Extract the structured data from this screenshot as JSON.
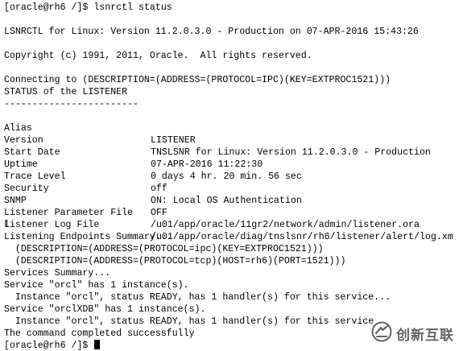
{
  "terminal": {
    "prompt": "[oracle@rh6 /]$ ",
    "command": "lsnrctl status",
    "banner": "LSNRCTL for Linux: Version 11.2.0.3.0 - Production on 07-APR-2016 15:43:26",
    "copyright": "Copyright (c) 1991, 2011, Oracle.  All rights reserved.",
    "connecting": "Connecting to (DESCRIPTION=(ADDRESS=(PROTOCOL=IPC)(KEY=EXTPROC1521)))",
    "status_header": "STATUS of the LISTENER",
    "separator": "------------------------",
    "status_rows": [
      {
        "key": "Alias",
        "value": "LISTENER"
      },
      {
        "key": "Version",
        "value": "TNSLSNR for Linux: Version 11.2.0.3.0 - Production"
      },
      {
        "key": "Start Date",
        "value": "07-APR-2016 11:22:30"
      },
      {
        "key": "Uptime",
        "value": "0 days 4 hr. 20 min. 56 sec"
      },
      {
        "key": "Trace Level",
        "value": "off"
      },
      {
        "key": "Security",
        "value": "ON: Local OS Authentication"
      },
      {
        "key": "SNMP",
        "value": "OFF"
      },
      {
        "key": "Listener Parameter File",
        "value": "/u01/app/oracle/11gr2/network/admin/listener.ora"
      },
      {
        "key": "Listener Log File",
        "value": "/u01/app/oracle/diag/tnslsnr/rh6/listener/alert/log.xm"
      }
    ],
    "log_wrap": "l",
    "endpoints_header": "Listening Endpoints Summary...",
    "endpoint_1": "  (DESCRIPTION=(ADDRESS=(PROTOCOL=ipc)(KEY=EXTPROC1521)))",
    "endpoint_2": "  (DESCRIPTION=(ADDRESS=(PROTOCOL=tcp)(HOST=rh6)(PORT=1521)))",
    "services_header": "Services Summary...",
    "service_1": "Service \"orcl\" has 1 instance(s).",
    "instance_1": "  Instance \"orcl\", status READY, has 1 handler(s) for this service...",
    "service_2": "Service \"orclXDB\" has 1 instance(s).",
    "instance_2": "  Instance \"orcl\", status READY, has 1 handler(s) for this service",
    "completed": "The command completed successfully",
    "final_prompt": "[oracle@rh6 /]$ "
  },
  "watermark": {
    "text": "创新互联",
    "icon": "brand-logo-icon",
    "color": "#4a4a4a"
  }
}
